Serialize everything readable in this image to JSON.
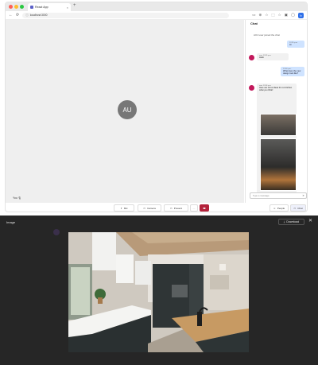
{
  "browser": {
    "tab_title": "React App",
    "tab_close": "×",
    "new_tab": "+",
    "url": "localhost:3000",
    "nav": [
      "←",
      "⟳"
    ],
    "colors": {
      "close": "#ff5f57",
      "min": "#febc2e",
      "max": "#28c840"
    }
  },
  "stage": {
    "avatar_initials": "AU",
    "self_label": "You 🎙"
  },
  "chat": {
    "title": "Chat",
    "system_message": "AOJ user joined the chat",
    "messages": [
      {
        "dir": "out",
        "meta": "12:35 p.m.",
        "text": "Hi"
      },
      {
        "dir": "in",
        "sender": "user",
        "meta": "12:35 p.m.",
        "text": "Hello"
      },
      {
        "dir": "out",
        "meta": "12:36 p.m.",
        "text": "What does the new design look like?"
      },
      {
        "dir": "in",
        "sender": "user",
        "meta": "12:36 p.m.",
        "text": "Here are some ideas for our kitchen what you think!"
      }
    ],
    "input_placeholder": "Type a message",
    "send_icon": "➤"
  },
  "toolbar": {
    "mic": "Mic",
    "camera": "Camera",
    "present": "Present",
    "more": "···",
    "end": "☎",
    "people": "People",
    "chat": "Chat"
  },
  "viewer": {
    "title": "Image",
    "download": "Download",
    "close": "✕"
  }
}
